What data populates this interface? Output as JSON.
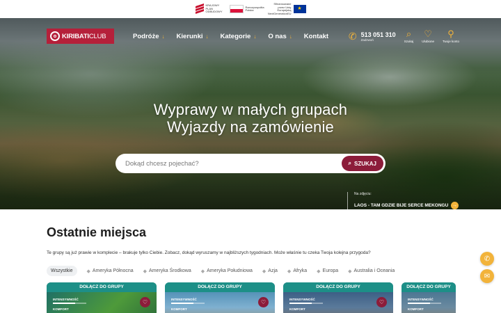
{
  "eu_strip": {
    "kpo_text": "KRAJOWY PLAN ODBUDOWY",
    "rp_text": "Rzeczpospolita Polska",
    "eu_text": "Sfinansowane przez Unię Europejską NextGenerationEU"
  },
  "header": {
    "logo_bold": "KIRIBATI",
    "logo_light": "CLUB",
    "nav": [
      {
        "label": "Podróże",
        "has_arrow": true
      },
      {
        "label": "Kierunki",
        "has_arrow": true
      },
      {
        "label": "Kategorie",
        "has_arrow": true
      },
      {
        "label": "O nas",
        "has_arrow": true
      },
      {
        "label": "Kontakt",
        "has_arrow": false
      }
    ],
    "phone": "513 051 310",
    "phone_sub": "Zadzwoń",
    "utilities": [
      {
        "label": "Szukaj",
        "icon": "search-icon"
      },
      {
        "label": "Ulubione",
        "icon": "heart-icon"
      },
      {
        "label": "Twoje konto",
        "icon": "user-icon"
      }
    ]
  },
  "hero": {
    "line1": "Wyprawy w małych grupach",
    "line2": "Wyjazdy na zamówienie",
    "search_placeholder": "Dokąd chcesz pojechać?",
    "search_button": "SZUKAJ",
    "caption_label": "Na zdjęciu:",
    "caption_text": "LAOS - TAM GDZIE BIJE SERCE MEKONGU"
  },
  "main": {
    "title": "Ostatnie miejsca",
    "description": "Te grupy są już prawie w komplecie – brakuje tylko Ciebie. Zobacz, dokąd wyruszamy w najbliższych tygodniach. Może właśnie tu czeka Twoja kolejna przygoda?",
    "filters": [
      {
        "label": "Wszystkie",
        "active": true
      },
      {
        "label": "Ameryka Północna",
        "active": false
      },
      {
        "label": "Ameryka Środkowa",
        "active": false
      },
      {
        "label": "Ameryka Południowa",
        "active": false
      },
      {
        "label": "Azja",
        "active": false
      },
      {
        "label": "Afryka",
        "active": false
      },
      {
        "label": "Europa",
        "active": false
      },
      {
        "label": "Australia i Oceania",
        "active": false
      }
    ],
    "cards": [
      {
        "banner": "DOŁĄCZ DO GRUPY",
        "meta1": "INTENSYWNOŚĆ",
        "meta2": "KOMFORT"
      },
      {
        "banner": "DOŁĄCZ DO GRUPY",
        "meta1": "INTENSYWNOŚĆ",
        "meta2": "KOMFORT"
      },
      {
        "banner": "DOŁĄCZ DO GRUPY",
        "meta1": "INTENSYWNOŚĆ",
        "meta2": "KOMFORT"
      },
      {
        "banner": "DOŁĄCZ DO GRUPY",
        "meta1": "INTENSYWNOŚĆ",
        "meta2": "KOMFORT"
      }
    ]
  },
  "colors": {
    "brand": "#b5203a",
    "accent": "#f2b33a",
    "search_button": "#8c1c3a",
    "card_banner": "#1d8f87"
  }
}
